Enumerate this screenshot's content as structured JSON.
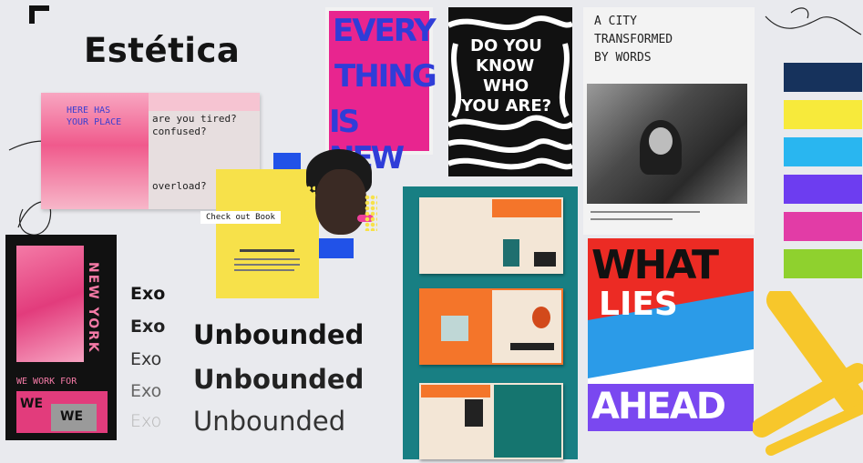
{
  "board": {
    "title": "Estética",
    "background": "#e9eaee"
  },
  "zine": {
    "line1": "are you tired?",
    "line2": "confused?",
    "line3": "overload?",
    "overlay_line1": "HERE HAS",
    "overlay_line2": "YOUR PLACE",
    "accent": "#f05a8c"
  },
  "poster_everything": {
    "line1": "EVERY",
    "line2": "THING",
    "line3": "IS NEW",
    "background": "#e8258f",
    "text_color": "#2f3dd8"
  },
  "poster_who": {
    "line1": "DO YOU",
    "line2": "KNOW",
    "line3": "WHO",
    "line4": "YOU ARE?"
  },
  "city_card": {
    "line1": "A CITY",
    "line2": "TRANSFORMED",
    "line3": "BY WORDS"
  },
  "pink_poster": {
    "vertical_text": "NEW YORK",
    "line1": "WE WORK FOR",
    "line2": "WE",
    "line3": "WE"
  },
  "yellow_flyer": {
    "label": "Check out Book",
    "accent": "#f7e14a"
  },
  "fonts": {
    "exo": [
      "Exo",
      "Exo",
      "Exo",
      "Exo",
      "Exo"
    ],
    "unbounded": [
      "Unbounded",
      "Unbounded",
      "Unbounded"
    ]
  },
  "what_poster": {
    "word1": "WHAT",
    "word2": "LIES",
    "word3": "AHEAD"
  },
  "palette": [
    "#16325c",
    "#f7ea3b",
    "#29b6f0",
    "#6d3df0",
    "#e23ca6",
    "#8fd12e"
  ]
}
